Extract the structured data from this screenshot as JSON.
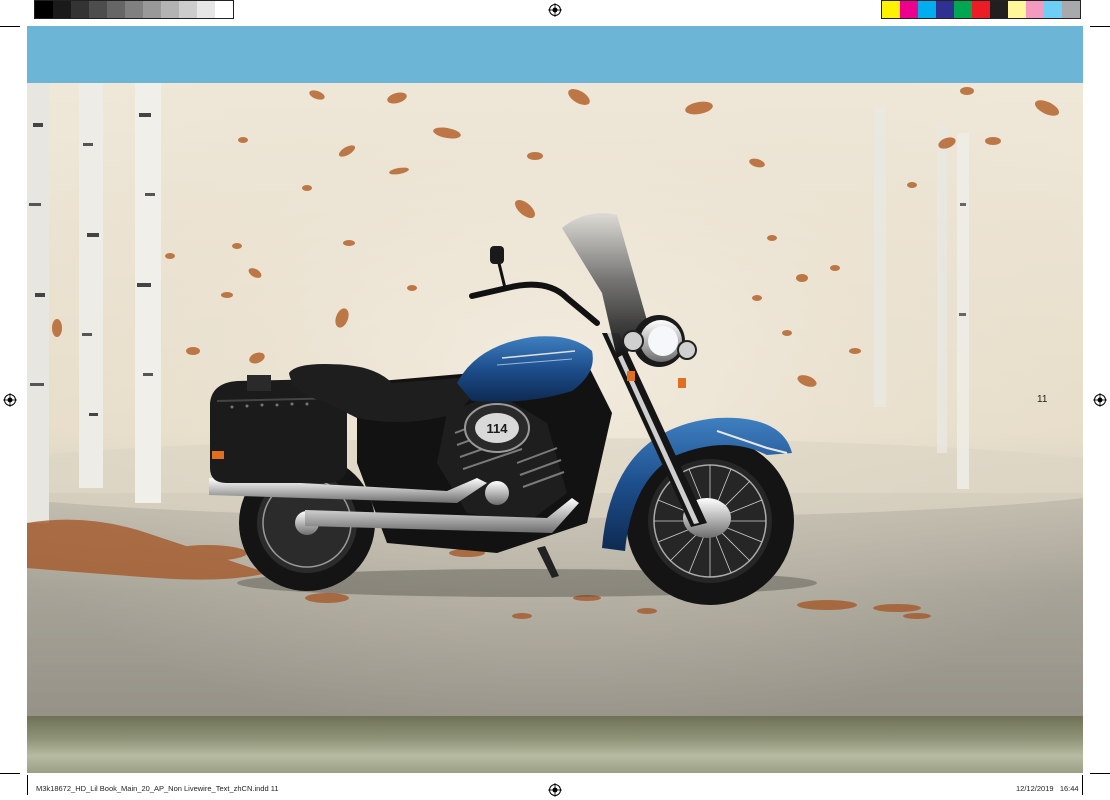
{
  "page_number": "11",
  "footer": {
    "file_label": "M3k18672_HD_Lil Book_Main_20_AP_Non Livewire_Text_zhCN.indd   11",
    "date": "12/12/2019",
    "time": "16:44"
  },
  "engine_badge": "114",
  "colors": {
    "top_band": "#6cb5d6",
    "tank": "#1d4e8c",
    "leaves": "#b4642d"
  },
  "calibration_strip": {
    "grays": [
      "#000000",
      "#1a1a1a",
      "#333333",
      "#4d4d4d",
      "#666666",
      "#808080",
      "#999999",
      "#b3b3b3",
      "#cccccc",
      "#e6e6e6",
      "#ffffff"
    ],
    "colors": [
      "#fff200",
      "#ec008c",
      "#00aeef",
      "#2e3192",
      "#00a651",
      "#ed1c24",
      "#231f20",
      "#fff799",
      "#f49ac1",
      "#6dcff6",
      "#a7a9ac"
    ]
  }
}
